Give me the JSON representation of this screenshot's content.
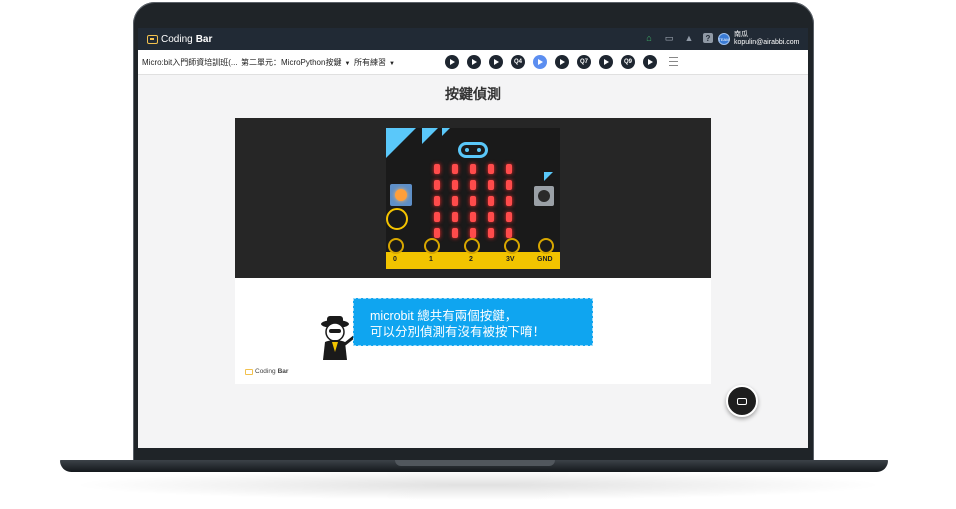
{
  "app": {
    "brand_prefix": "Coding",
    "brand_bold": "Bar"
  },
  "topbar": {
    "icons": [
      "home-icon",
      "chat-icon",
      "bell-icon",
      "help-icon"
    ],
    "user_name": "南瓜",
    "user_email": "kopulin@airabbi.com",
    "avatar_text": "TEAM"
  },
  "nav": {
    "course": "Micro:bit入門師資培訓班(...",
    "unit": "第二單元：MicroPython按鍵",
    "practice": "所有練習",
    "quiz_buttons": [
      "",
      "",
      "",
      "Q4",
      "",
      "",
      "Q7",
      "",
      "Q9",
      ""
    ],
    "active_index": 4
  },
  "page": {
    "title": "按鍵偵測"
  },
  "microbit": {
    "pin_labels": [
      "0",
      "1",
      "2",
      "3V",
      "GND"
    ]
  },
  "lesson": {
    "speech_line1": "microbit 總共有兩個按鍵，",
    "speech_line2": "可以分別偵測有沒有被按下唷！",
    "card_logo_prefix": "Coding",
    "card_logo_bold": "Bar"
  },
  "colors": {
    "topbar": "#212a35",
    "accent": "#5c8ef0",
    "speech": "#0fa5f0",
    "led": "#ff4b4b"
  }
}
